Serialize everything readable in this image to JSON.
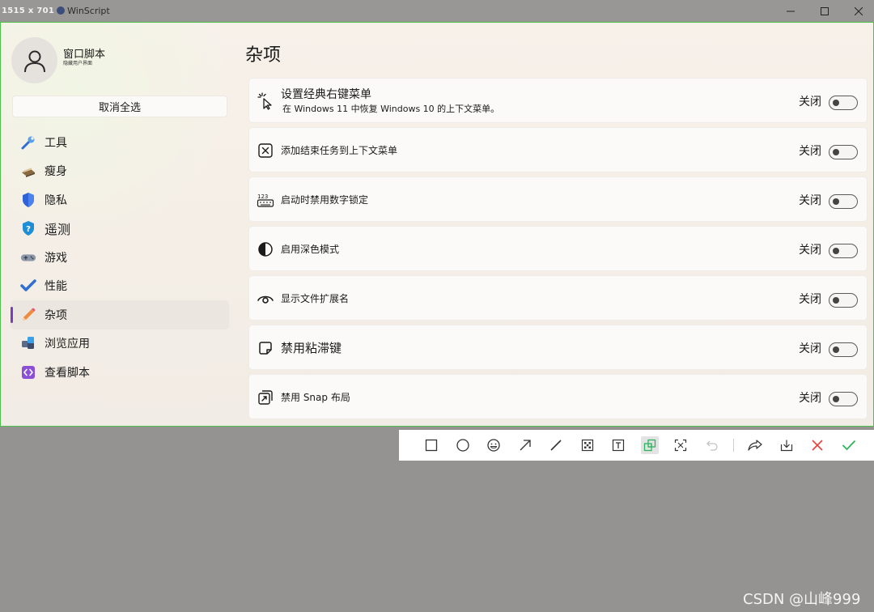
{
  "titlebar": {
    "size_tag": "1515 x 701",
    "app_name": "WinScript"
  },
  "user": {
    "name": "窗口脚本",
    "subtitle": "隐藏用户界面"
  },
  "sidebar": {
    "deselect_all_label": "取消全选",
    "items": [
      {
        "label": "工具",
        "icon": "wrench-icon"
      },
      {
        "label": "瘦身",
        "icon": "broom-icon"
      },
      {
        "label": "隐私",
        "icon": "shield-icon"
      },
      {
        "label": "遥测",
        "icon": "question-shield-icon"
      },
      {
        "label": "游戏",
        "icon": "gamepad-icon"
      },
      {
        "label": "性能",
        "icon": "checkmark-icon"
      },
      {
        "label": "杂项",
        "icon": "pencil-icon",
        "active": true
      },
      {
        "label": "浏览应用",
        "icon": "apps-icon"
      },
      {
        "label": "查看脚本",
        "icon": "code-icon"
      }
    ]
  },
  "main": {
    "title": "杂项",
    "settings": [
      {
        "title": "设置经典右键菜单",
        "description": "在 Windows 11 中恢复 Windows 10 的上下文菜单。",
        "state": "关闭",
        "enabled": false,
        "icon": "cursor-click-icon"
      },
      {
        "title": "添加结束任务到上下文菜单",
        "state": "关闭",
        "enabled": false,
        "icon": "close-box-icon"
      },
      {
        "title": "启动时禁用数字锁定",
        "state": "关闭",
        "enabled": false,
        "icon": "numpad-icon"
      },
      {
        "title": "启用深色模式",
        "state": "关闭",
        "enabled": false,
        "icon": "contrast-icon"
      },
      {
        "title": "显示文件扩展名",
        "state": "关闭",
        "enabled": false,
        "icon": "eye-icon"
      },
      {
        "title": "禁用粘滞键",
        "state": "关闭",
        "enabled": false,
        "icon": "sticky-note-icon"
      },
      {
        "title": "禁用 Snap 布局",
        "state": "关闭",
        "enabled": false,
        "icon": "snap-layout-icon"
      }
    ]
  },
  "snip_toolbar": {
    "tools": [
      "rectangle-icon",
      "ellipse-icon",
      "emoji-icon",
      "arrow-icon",
      "line-icon",
      "mosaic-icon",
      "text-icon",
      "pin-icon",
      "ocr-icon",
      "undo-icon",
      "share-icon",
      "download-icon",
      "cancel-icon",
      "confirm-icon"
    ],
    "accent_green": "#2db55d",
    "accent_red": "#e8413c"
  },
  "watermark": "CSDN @山峰999"
}
